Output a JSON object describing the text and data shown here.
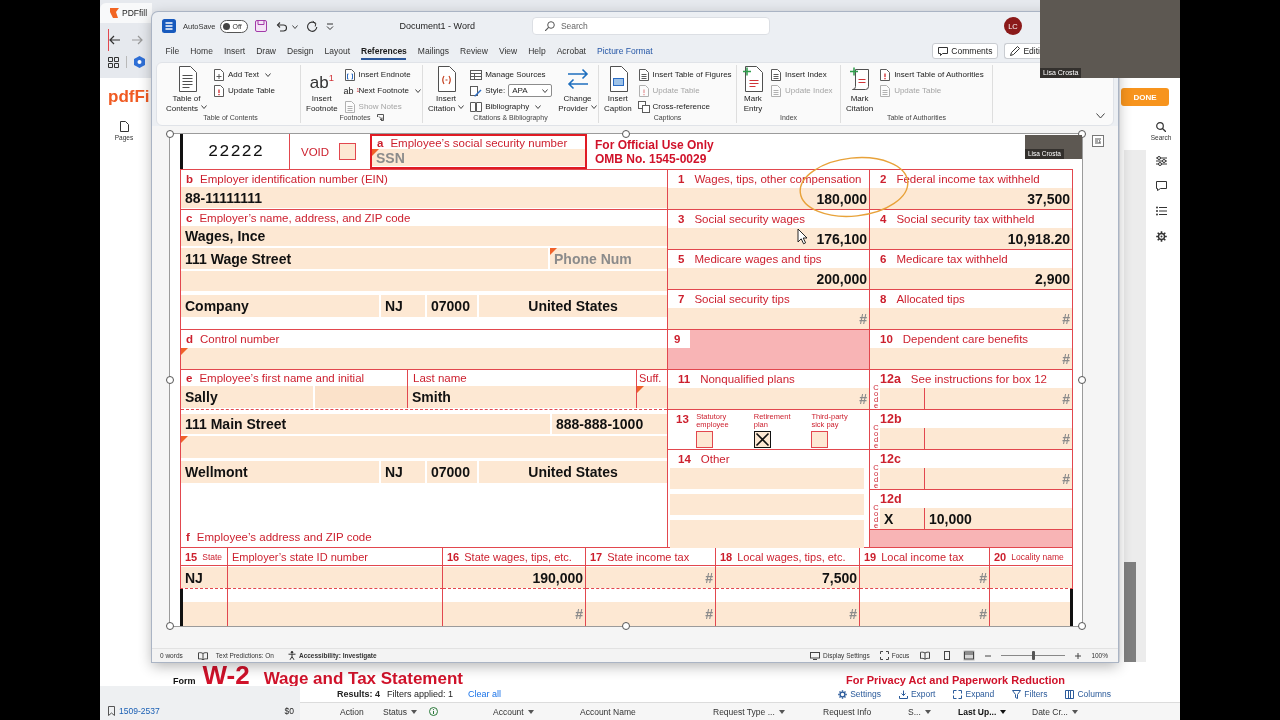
{
  "browser": {
    "tab_title": "PDFfill",
    "logo": "pdfFi",
    "pages_label": "Pages",
    "done_button": "DONE",
    "search_label": "Search"
  },
  "word": {
    "quick_access": {
      "autosave_label": "AutoSave",
      "autosave": {
        "label": "Off",
        "on": false
      }
    },
    "title": "Document1 - Word",
    "search": {
      "placeholder": "Search"
    },
    "avatar": "LC",
    "menu_tabs": [
      {
        "label": "File",
        "kind": "standard",
        "selected": false
      },
      {
        "label": "Home",
        "kind": "standard",
        "selected": false
      },
      {
        "label": "Insert",
        "kind": "standard",
        "selected": false
      },
      {
        "label": "Draw",
        "kind": "standard",
        "selected": false
      },
      {
        "label": "Design",
        "kind": "standard",
        "selected": false
      },
      {
        "label": "Layout",
        "kind": "standard",
        "selected": false
      },
      {
        "label": "References",
        "kind": "standard",
        "selected": true
      },
      {
        "label": "Mailings",
        "kind": "standard",
        "selected": false
      },
      {
        "label": "Review",
        "kind": "standard",
        "selected": false
      },
      {
        "label": "View",
        "kind": "standard",
        "selected": false
      },
      {
        "label": "Help",
        "kind": "standard",
        "selected": false
      },
      {
        "label": "Acrobat",
        "kind": "standard",
        "selected": false
      },
      {
        "label": "Picture Format",
        "kind": "contextual",
        "selected": false
      }
    ],
    "comments_button": "Comments",
    "editing_button": "Editi",
    "ribbon_groups": [
      {
        "title": "Table of Contents",
        "launcher": false,
        "items": [
          {
            "kind": "large",
            "label": "Table of\nContents",
            "dropdown": true,
            "disabled": false
          },
          {
            "kind": "small",
            "label": "Add Text",
            "dropdown": true,
            "disabled": false
          },
          {
            "kind": "small",
            "label": "Update Table",
            "dropdown": false,
            "disabled": false
          }
        ]
      },
      {
        "title": "Footnotes",
        "launcher": true,
        "items": [
          {
            "kind": "large",
            "label": "Insert\nFootnote",
            "icon_text": "ab$^{1}$",
            "dropdown": false,
            "disabled": false
          },
          {
            "kind": "small",
            "label": "Insert Endnote",
            "dropdown": false,
            "disabled": false
          },
          {
            "kind": "small",
            "label": "Next Footnote",
            "icon_text": "ab$^{1}$",
            "dropdown": true,
            "disabled": false
          },
          {
            "kind": "small",
            "label": "Show Notes",
            "dropdown": false,
            "disabled": true
          }
        ]
      },
      {
        "title": "Citations & Bibliography",
        "launcher": false,
        "items": [
          {
            "kind": "large",
            "label": "Insert\nCitation",
            "dropdown": true,
            "disabled": false
          },
          {
            "kind": "small",
            "label": "Manage Sources",
            "dropdown": false,
            "disabled": false
          },
          {
            "kind": "style",
            "label": "Style:",
            "value": "APA",
            "dropdown": true,
            "disabled": false
          },
          {
            "kind": "small",
            "label": "Bibliography",
            "dropdown": true,
            "disabled": false
          },
          {
            "kind": "large",
            "label": "Change\nProvider",
            "dropdown": true,
            "disabled": false
          }
        ]
      },
      {
        "title": "Captions",
        "launcher": false,
        "items": [
          {
            "kind": "large",
            "label": "Insert\nCaption",
            "dropdown": false,
            "disabled": false
          },
          {
            "kind": "small",
            "label": "Insert Table of Figures",
            "dropdown": false,
            "disabled": false
          },
          {
            "kind": "small",
            "label": "Update Table",
            "dropdown": false,
            "disabled": true
          },
          {
            "kind": "small",
            "label": "Cross-reference",
            "dropdown": false,
            "disabled": false
          }
        ]
      },
      {
        "title": "Index",
        "launcher": false,
        "items": [
          {
            "kind": "large",
            "label": "Mark\nEntry",
            "dropdown": false,
            "disabled": false
          },
          {
            "kind": "small",
            "label": "Insert Index",
            "dropdown": false,
            "disabled": false
          },
          {
            "kind": "small",
            "label": "Update Index",
            "dropdown": false,
            "disabled": true
          }
        ]
      },
      {
        "title": "Table of Authorities",
        "launcher": false,
        "items": [
          {
            "kind": "large",
            "label": "Mark\nCitation",
            "dropdown": false,
            "disabled": false
          },
          {
            "kind": "small",
            "label": "Insert Table of Authorities",
            "dropdown": false,
            "disabled": false
          },
          {
            "kind": "small",
            "label": "Update Table",
            "dropdown": false,
            "disabled": true
          }
        ]
      }
    ],
    "status_bar": {
      "words": "0 words",
      "text_predictions": "Text Predictions: On",
      "accessibility": "Accessibility: Investigate",
      "display_settings": "Display Settings",
      "focus": "Focus",
      "view_modes": [
        {
          "selected": false
        },
        {
          "selected": false
        },
        {
          "selected": true
        }
      ],
      "zoom_slider": {
        "level": 0.5
      },
      "zoom": "100%"
    }
  },
  "document": {
    "form_code": "22222",
    "void": {
      "label": "VOID",
      "checked": false
    },
    "ssn": {
      "letter": "a",
      "label": "Employee’s social security number",
      "placeholder": "SSN",
      "required": true
    },
    "official_use": "For Official Use Only",
    "omb_number": "OMB No. 1545-0029",
    "employer_id": {
      "letter": "b",
      "label": "Employer identification number (EIN)",
      "field": {
        "value": "88-11111111"
      }
    },
    "employer": {
      "letter": "c",
      "label": "Employer’s name, address, and ZIP code",
      "name": "Wages, Ince",
      "street": "111 Wage Street",
      "phone": {
        "placeholder": "Phone Num",
        "required": true
      },
      "city": "Company",
      "state": "NJ",
      "zip": "07000",
      "country": "United States"
    },
    "control_number": {
      "letter": "d",
      "label": "Control number",
      "required": true
    },
    "employee": {
      "letter": "e",
      "first_name_label": "Employee’s first name and initial",
      "last_name_label": "Last name",
      "suffix_label": "Suff.",
      "first_name": "Sally",
      "last_name": "Smith",
      "suffix_required": true,
      "street": "111 Main Street",
      "phone": "888-888-1000",
      "address_line_2_required": true,
      "city": "Wellmont",
      "state": "NJ",
      "zip": "07000",
      "country": "United States",
      "address_letter": "f",
      "address_label": "Employee’s address and ZIP code"
    },
    "right_boxes": [
      {
        "kind": "amount",
        "number": "1",
        "label": "Wages, tips, other compensation",
        "field": {
          "value": "180,000"
        }
      },
      {
        "kind": "amount",
        "number": "2",
        "label": "Federal income tax withheld",
        "field": {
          "value": "37,500"
        }
      },
      {
        "kind": "amount",
        "number": "3",
        "label": "Social security wages",
        "field": {
          "value": "176,100"
        }
      },
      {
        "kind": "amount",
        "number": "4",
        "label": "Social security tax withheld",
        "field": {
          "value": "10,918.20"
        }
      },
      {
        "kind": "amount",
        "number": "5",
        "label": "Medicare wages and tips",
        "field": {
          "value": "200,000"
        }
      },
      {
        "kind": "amount",
        "number": "6",
        "label": "Medicare tax withheld",
        "field": {
          "value": "2,900"
        }
      },
      {
        "kind": "amount",
        "number": "7",
        "label": "Social security tips",
        "field": {
          "placeholder": "#"
        }
      },
      {
        "kind": "amount",
        "number": "8",
        "label": "Allocated tips",
        "field": {
          "placeholder": "#"
        }
      },
      {
        "kind": "shaded",
        "number": "9"
      },
      {
        "kind": "amount",
        "number": "10",
        "label": "Dependent care benefits",
        "field": {
          "placeholder": "#"
        }
      },
      {
        "kind": "amount",
        "number": "11",
        "label": "Nonqualified plans",
        "field": {
          "placeholder": "#"
        }
      },
      {
        "kind": "code",
        "number": "12a",
        "label": "See instructions for box 12",
        "code_label": "Code",
        "amount": {
          "placeholder": "#"
        }
      },
      {
        "kind": "checkboxes",
        "number": "13",
        "options": [
          {
            "label": "Statutory\nemployee",
            "checked": false
          },
          {
            "label": "Retirement\nplan",
            "checked": true
          },
          {
            "label": "Third-party\nsick pay",
            "checked": false
          }
        ]
      },
      {
        "kind": "code",
        "number": "12b",
        "code_label": "Code",
        "amount": {
          "placeholder": "#"
        }
      },
      {
        "kind": "other",
        "number": "14",
        "label": "Other"
      },
      {
        "kind": "code",
        "number": "12c",
        "code_label": "Code",
        "amount": {
          "placeholder": "#"
        }
      },
      {
        "kind": "code",
        "number": "12d",
        "code_label": "Code",
        "code": {
          "value": "X"
        },
        "amount": {
          "value": "10,000"
        }
      },
      {
        "kind": "shaded"
      }
    ],
    "state_table": {
      "columns": [
        {
          "number": "15",
          "label": "State"
        },
        {
          "label": "Employer’s state ID number"
        },
        {
          "number": "16",
          "label": "State wages, tips, etc."
        },
        {
          "number": "17",
          "label": "State income tax"
        },
        {
          "number": "18",
          "label": "Local wages, tips, etc."
        },
        {
          "number": "19",
          "label": "Local income tax"
        },
        {
          "number": "20",
          "label": "Locality name"
        }
      ],
      "rows": [
        [
          {
            "value": "NJ"
          },
          {
            "kind": "blank"
          },
          {
            "value": "190,000"
          },
          {
            "placeholder": "#"
          },
          {
            "value": "7,500"
          },
          {
            "placeholder": "#"
          },
          {
            "kind": "blank"
          }
        ],
        [
          {
            "kind": "blank"
          },
          {
            "kind": "blank"
          },
          {
            "placeholder": "#"
          },
          {
            "placeholder": "#"
          },
          {
            "placeholder": "#"
          },
          {
            "placeholder": "#"
          },
          {
            "kind": "blank"
          }
        ]
      ]
    }
  },
  "video_tiles": [
    {
      "name": "Lisa Crosta"
    },
    {
      "name": "Lisa Crosta"
    }
  ],
  "pdf_page": {
    "form_label": "Form",
    "form_code": "W-2",
    "form_title": "Wage and Tax Statement",
    "privacy_note": "For Privacy Act and Paperwork Reduction"
  },
  "documents_panel": {
    "sidebar_items": [
      {
        "title": "1509-2537",
        "amount": "$0"
      }
    ],
    "results": "Results: 4",
    "filters_applied": "Filters applied: 1",
    "clear_all": "Clear all",
    "toolbar": [
      "Settings",
      "Export",
      "Expand",
      "Filters",
      "Columns"
    ],
    "columns": [
      {
        "label": "Action",
        "filter": false,
        "info": false,
        "sorted": false
      },
      {
        "label": "Status",
        "filter": true,
        "info": true,
        "sorted": false
      },
      {
        "label": "Account",
        "filter": true,
        "info": false,
        "sorted": false
      },
      {
        "label": "Account Name",
        "filter": false,
        "info": false,
        "sorted": false
      },
      {
        "label": "Request Type ...",
        "filter": true,
        "info": false,
        "sorted": false
      },
      {
        "label": "Request Info",
        "filter": false,
        "info": false,
        "sorted": false
      },
      {
        "label": "S...",
        "filter": true,
        "info": false,
        "sorted": false
      },
      {
        "label": "Last Up...",
        "filter": true,
        "info": false,
        "sorted": true
      },
      {
        "label": "Date Cr...",
        "filter": true,
        "info": false,
        "sorted": false
      }
    ]
  }
}
